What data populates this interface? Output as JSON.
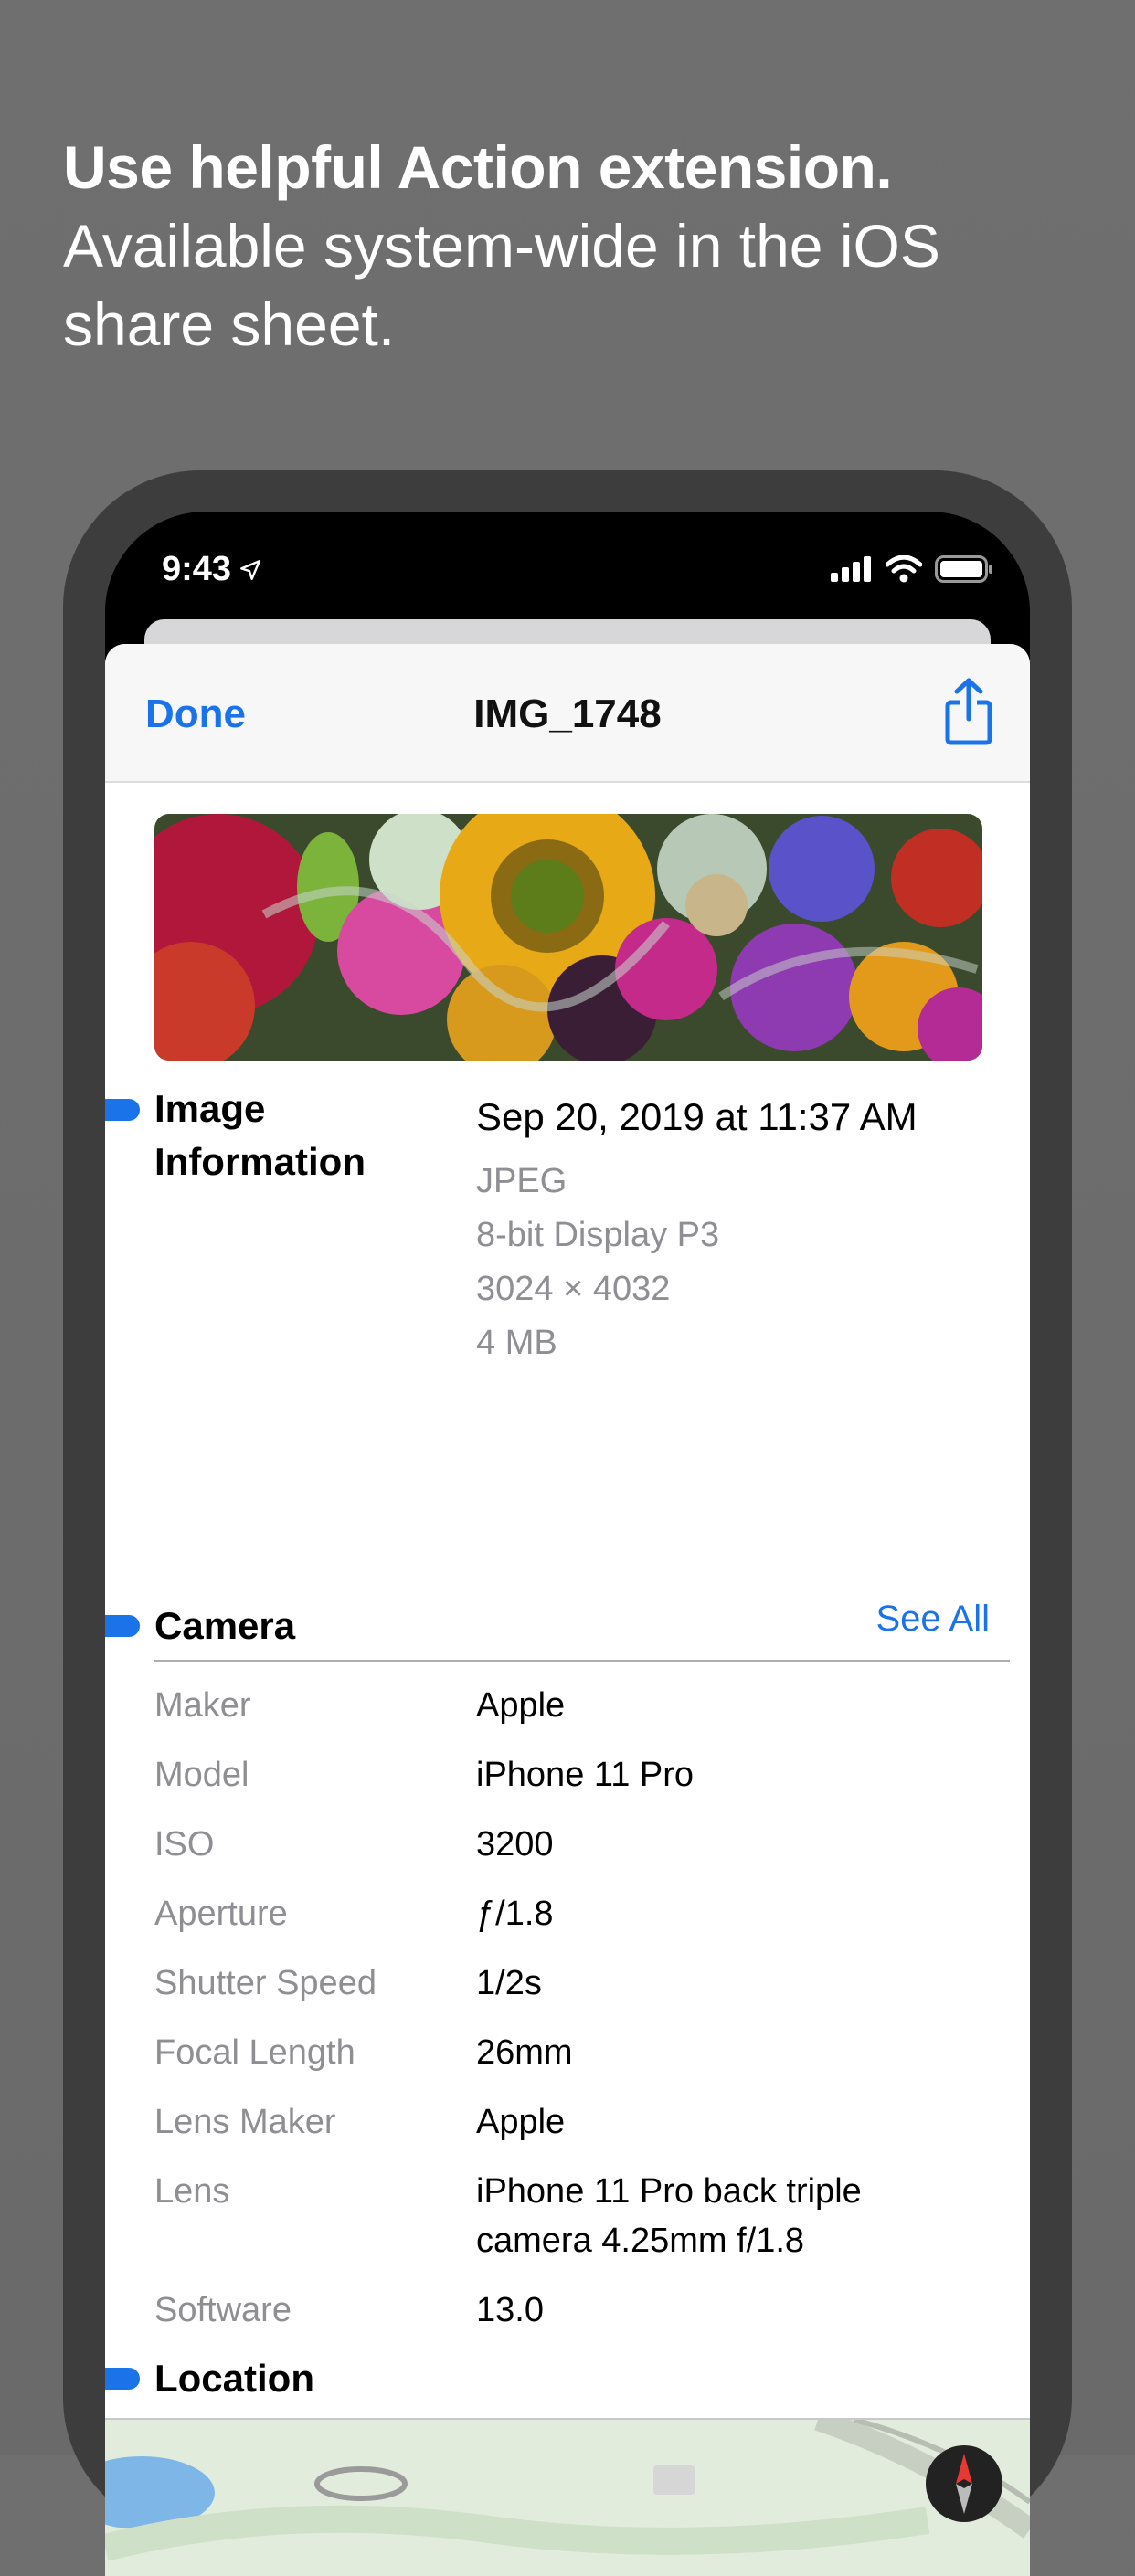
{
  "promo": {
    "headline": "Use helpful Action extension.",
    "subline_1": "Available system-wide in the iOS",
    "subline_2": "share sheet."
  },
  "status_bar": {
    "time": "9:43"
  },
  "sheet": {
    "done_label": "Done",
    "title": "IMG_1748"
  },
  "image_info": {
    "title_line_1": "Image",
    "title_line_2": "Information",
    "date": "Sep 20, 2019 at 11:37 AM",
    "format": "JPEG",
    "color_profile": "8-bit Display P3",
    "dimensions": "3024 × 4032",
    "size": "4 MB"
  },
  "camera": {
    "title": "Camera",
    "see_all_label": "See All",
    "rows": [
      {
        "label": "Maker",
        "value": "Apple"
      },
      {
        "label": "Model",
        "value": "iPhone 11 Pro"
      },
      {
        "label": "ISO",
        "value": "3200"
      },
      {
        "label": "Aperture",
        "value": "ƒ/1.8"
      },
      {
        "label": "Shutter Speed",
        "value": "1/2s"
      },
      {
        "label": "Focal Length",
        "value": "26mm"
      },
      {
        "label": "Lens Maker",
        "value": "Apple"
      },
      {
        "label": "Lens",
        "value": "iPhone 11 Pro back triple camera 4.25mm f/1.8"
      },
      {
        "label": "Software",
        "value": "13.0"
      }
    ]
  },
  "location": {
    "title": "Location"
  },
  "colors": {
    "accent": "#1a73e8",
    "secondary_text": "#8e8e93"
  }
}
